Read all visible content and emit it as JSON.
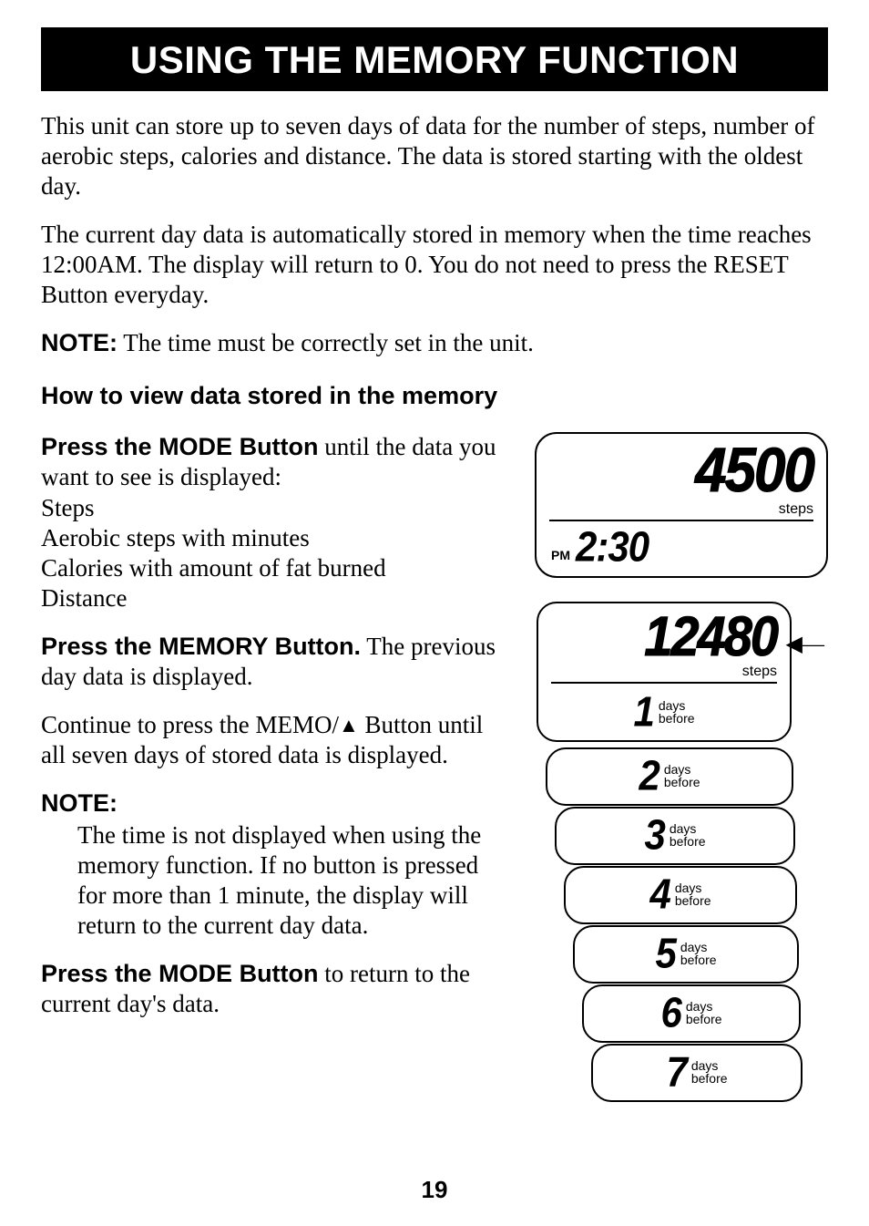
{
  "title": "USING THE MEMORY FUNCTION",
  "para1": "This unit can store up to seven days of data for the number of steps, number of aerobic steps, calories and distance. The data is stored starting with the oldest day.",
  "para2": "The current day data is automatically stored in memory when the time reaches 12:00AM. The display will return to 0. You do not need to press the RESET Button everyday.",
  "note_label": "NOTE:",
  "note1_text": " The time must be correctly set in the unit.",
  "subhead": "How to view data stored in the memory",
  "step1_lead": "Press the MODE Button",
  "step1_rest": " until the data you want to see is displayed:",
  "modes": {
    "a": "Steps",
    "b": "Aerobic steps with minutes",
    "c": "Calories with amount of fat burned",
    "d": "Distance"
  },
  "step2_lead": "Press the MEMORY Button.",
  "step2_rest": " The previous day data is displayed.",
  "step2_cont_a": "Continue to press the MEMO/",
  "step2_cont_b": " Button until all seven days of stored data is displayed.",
  "note2_label": "NOTE:",
  "note2_text": "The time is not displayed when using the memory function. If no button is pressed for more than 1 minute, the display will return to the current day data.",
  "step3_lead": "Press the MODE Button",
  "step3_rest": " to return to the current day's data.",
  "page_number": "19",
  "lcd1": {
    "big": "4500",
    "steps_label": "steps",
    "pm": "PM",
    "time": "2:30"
  },
  "lcd2": {
    "big": "12480",
    "steps_label": "steps",
    "days_unit": "days",
    "before": "before",
    "days": [
      "1",
      "2",
      "3",
      "4",
      "5",
      "6",
      "7"
    ]
  }
}
